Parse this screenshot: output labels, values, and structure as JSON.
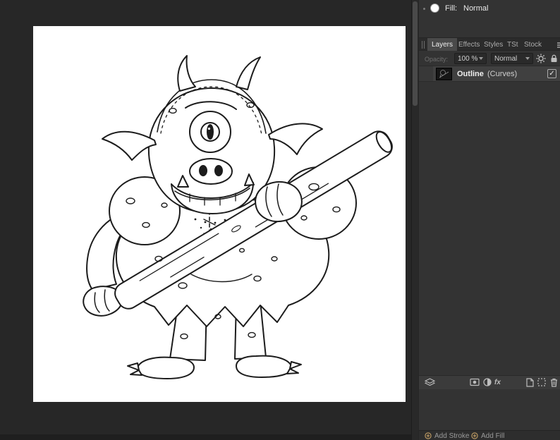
{
  "colors": {
    "canvas_bg": "#272727",
    "artboard_bg": "#ffffff",
    "panel_bg": "#333333",
    "active_tab_bg": "#4a4a4a",
    "selected_row_bg": "#404040",
    "line_art": "#1c1c1c",
    "add_button_icon": "#b59460"
  },
  "fill_indicator": {
    "label": "Fill:",
    "value": "Normal"
  },
  "layers_panel": {
    "tabs": [
      {
        "label": "Layers",
        "active": true
      },
      {
        "label": "Effects",
        "active": false
      },
      {
        "label": "Styles",
        "active": false
      },
      {
        "label": "TSt",
        "active": false
      },
      {
        "label": "Stock",
        "active": false
      }
    ],
    "opacity_label": "Opacity:",
    "opacity_value": "100 %",
    "blend_mode_value": "Normal",
    "fx_icon_label": "fx",
    "layers": [
      {
        "name": "Outline",
        "kind": "(Curves)",
        "visible": true
      }
    ]
  },
  "icons": {
    "checkmark": "✓",
    "footer": [
      "layers-stack-icon",
      "mask-icon",
      "adjustment-icon",
      "fx-icon",
      "new-layer-icon",
      "group-icon",
      "trash-icon"
    ]
  },
  "bottom_bar": {
    "add_stroke_label": "Add Stroke",
    "add_fill_label": "Add Fill"
  }
}
